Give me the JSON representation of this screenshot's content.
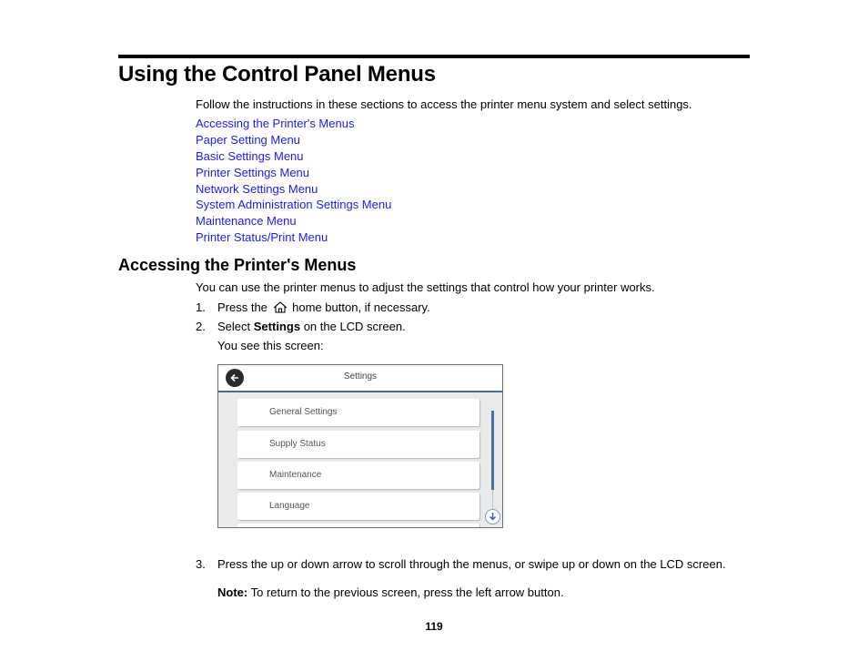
{
  "page": {
    "title": "Using the Control Panel Menus",
    "intro": "Follow the instructions in these sections to access the printer menu system and select settings.",
    "links": [
      "Accessing the Printer's Menus",
      "Paper Setting Menu",
      "Basic Settings Menu",
      "Printer Settings Menu",
      "Network Settings Menu",
      "System Administration Settings Menu",
      "Maintenance Menu",
      "Printer Status/Print Menu"
    ],
    "link_color": "#1a1aff",
    "page_number": "119"
  },
  "section": {
    "heading": "Accessing the Printer's Menus",
    "intro": "You can use the printer menus to adjust the settings that control how your printer works.",
    "steps": [
      {
        "num": "1.",
        "before": "Press the",
        "icon": "home-icon",
        "after": "home button, if necessary."
      },
      {
        "num": "2.",
        "before": "Select",
        "bold": "Settings",
        "after": "on the LCD screen."
      },
      {
        "num": "3.",
        "text": "Press the up or down arrow to scroll through the menus, or swipe up or down on the LCD screen."
      }
    ],
    "you_see": "You see this screen:",
    "note_label": "Note:",
    "note_text": "To return to the previous screen, press the left arrow button."
  },
  "lcd": {
    "title": "Settings",
    "back_icon": "back-arrow-icon",
    "scroll_icon": "arrow-down-icon",
    "items": [
      "General Settings",
      "Supply Status",
      "Maintenance",
      "Language"
    ],
    "accent": "#4a6fa8"
  }
}
